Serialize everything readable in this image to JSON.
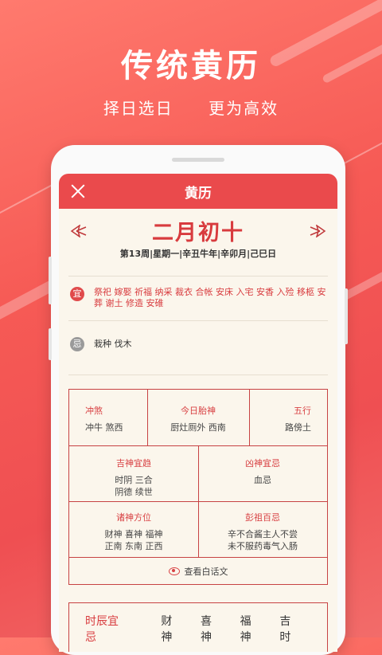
{
  "hero": {
    "title": "传统黄历",
    "sub_left": "择日选日",
    "sub_right": "更为高效"
  },
  "app": {
    "title": "黄历",
    "lunar_date": "二月初十",
    "ganzhi": "第13周|星期一|辛丑牛年|辛卯月|己巳日",
    "yi": {
      "badge": "宜",
      "text": "祭祀 嫁娶 祈福 纳采 裁衣 合帐 安床 入宅 安香 入殓 移柩 安葬 谢土 修造 安碓"
    },
    "ji": {
      "badge": "忌",
      "text": "栽种 伐木"
    },
    "table": {
      "chongsha": {
        "h": "冲煞",
        "v": "冲牛 煞西"
      },
      "taishen": {
        "h": "今日胎神",
        "v": "厨灶厕外 西南"
      },
      "wuxing": {
        "h": "五行",
        "v": "路傍土"
      },
      "jishen": {
        "h": "吉神宜趋",
        "v1": "时阴 三合",
        "v2": "阴德 续世"
      },
      "xiongshen": {
        "h": "凶神宜忌",
        "v": "血忌"
      },
      "zhushen": {
        "h": "诸神方位",
        "v1": "财神 喜神 福神",
        "v2": "正南 东南 正西"
      },
      "pengzu": {
        "h": "彭祖百忌",
        "v1": "辛不合酱主人不尝",
        "v2": "未不服药毒气入肠"
      },
      "view_label": "查看白话文"
    },
    "shichen": {
      "h": "时辰宜忌",
      "c1": "财神",
      "c2": "喜神",
      "c3": "福神",
      "c4": "吉时"
    }
  },
  "colors": {
    "accent": "#ea4a4c",
    "paper": "#fbf6ec"
  }
}
